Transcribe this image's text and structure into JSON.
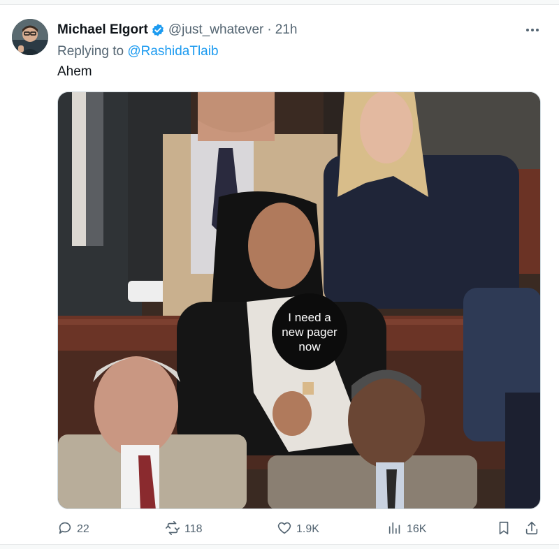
{
  "tweet": {
    "author_name": "Michael Elgort",
    "handle": "@just_whatever",
    "separator": "·",
    "time": "21h",
    "reply_prefix": "Replying to",
    "reply_to": "@RashidaTlaib",
    "text": "Ahem",
    "media_caption": "I need a new pager now",
    "verified_color": "#1d9bf0"
  },
  "actions": {
    "replies": "22",
    "reposts": "118",
    "likes": "1.9K",
    "views": "16K"
  },
  "icons": [
    "verified-badge-icon",
    "more-icon",
    "reply-icon",
    "repost-icon",
    "like-icon",
    "views-icon",
    "bookmark-icon",
    "share-icon"
  ]
}
